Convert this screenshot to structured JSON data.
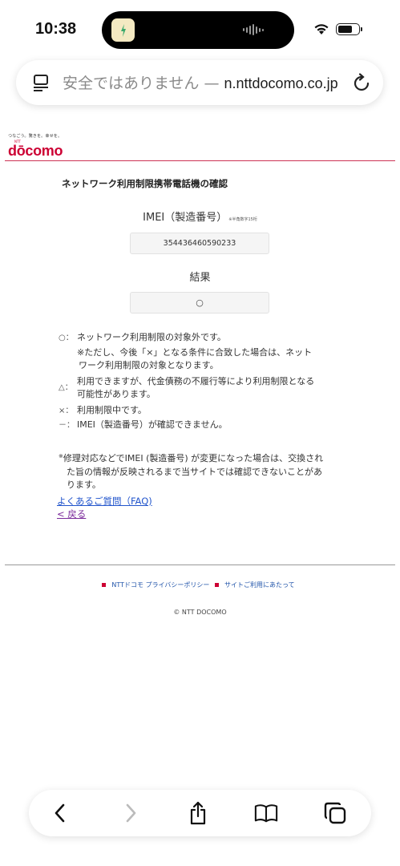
{
  "status_bar": {
    "time": "10:38"
  },
  "browser": {
    "url_prefix": "安全ではありません — ",
    "url_domain": "n.nttdocomo.co.jp"
  },
  "header": {
    "tagline": "つなごう。驚きを。幸せを。",
    "logo_small": "NTT",
    "logo": "dōcomo",
    "brand_color": "#cc0033"
  },
  "main": {
    "title": "ネットワーク利用制限携帯電話機の確認",
    "imei_label": "IMEI（製造番号）",
    "imei_note": "※半角数字15桁",
    "imei_value": "354436460590233",
    "result_label": "結果",
    "result_value": "○"
  },
  "legend": [
    {
      "symbol": "○：",
      "lines": [
        "ネットワーク利用制限の対象外です。"
      ]
    },
    {
      "symbol": "",
      "lines": [
        "※ただし、今後「×」となる条件に合致した場合は、ネット",
        "ワーク利用制限の対象となります。"
      ]
    },
    {
      "symbol": "△：",
      "lines": [
        "利用できますが、代金債務の不履行等により利用制限となる",
        "可能性があります。"
      ]
    },
    {
      "symbol": "×：",
      "lines": [
        "利用制限中です。"
      ]
    },
    {
      "symbol": "－：",
      "lines": [
        "IMEI（製造番号）が確認できません。"
      ]
    }
  ],
  "footnote": {
    "mark": "※",
    "lines": [
      "修理対応などでIMEI (製造番号) が変更になった場合は、交換され",
      "た旨の情報が反映されるまで当サイトでは確認できないことがあ",
      "ります。"
    ]
  },
  "links": {
    "faq": "よくあるご質問（FAQ)",
    "back": "< 戻る"
  },
  "footer": {
    "link1": "NTTドコモ プライバシーポリシー",
    "link2": "サイトご利用にあたって",
    "copyright": "© NTT DOCOMO"
  },
  "toolbar_icons": [
    "back-icon",
    "forward-icon",
    "share-icon",
    "bookmarks-icon",
    "tabs-icon"
  ]
}
